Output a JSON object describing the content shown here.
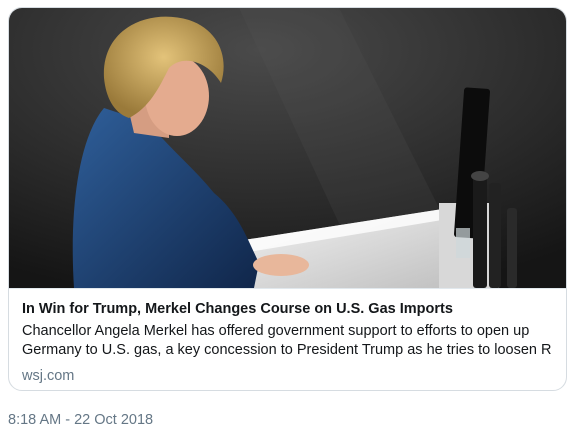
{
  "card": {
    "image_alt": "Angela Merkel speaking at a lectern",
    "title": "In Win for Trump, Merkel Changes Course on U.S. Gas Imports",
    "description_line1": "Chancellor Angela Merkel has offered government support to efforts to open up",
    "description_line2": "Germany to U.S. gas, a key concession to President Trump as he tries to loosen R...",
    "domain": "wsj.com"
  },
  "tweet": {
    "time": "8:18 AM",
    "separator": " - ",
    "date": "22 Oct 2018"
  }
}
